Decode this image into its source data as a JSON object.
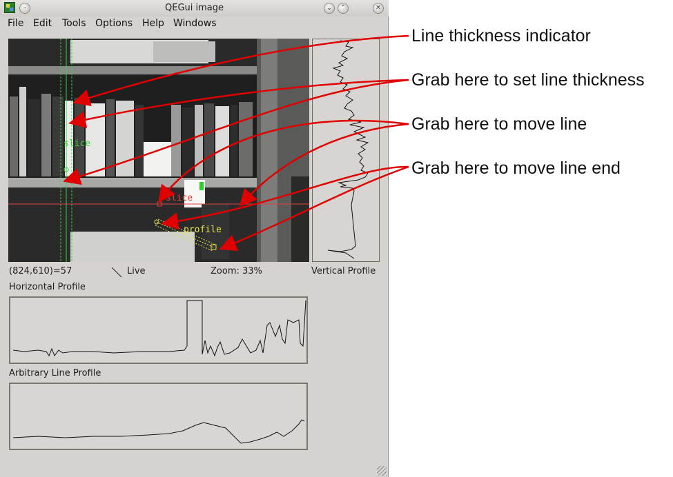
{
  "window": {
    "title": "QEGui image",
    "menu": [
      "File",
      "Edit",
      "Tools",
      "Options",
      "Help",
      "Windows"
    ]
  },
  "titlebar_buttons": {
    "menu": "–",
    "minimize": "⌄",
    "maximize": "⌃",
    "close": "✕"
  },
  "image": {
    "labels": {
      "vertical_slice": "slice",
      "horizontal_slice": "slice",
      "profile": "profile"
    }
  },
  "status": {
    "coords": "(824,610)=57",
    "mode": "Live",
    "zoom": "Zoom: 33%",
    "vertical_profile": "Vertical Profile"
  },
  "sections": {
    "horizontal": "Horizontal Profile",
    "arbitrary": "Arbitrary Line Profile"
  },
  "annotations": [
    "Line thickness indicator",
    "Grab here to set line thickness",
    "Grab here to move line",
    "Grab here to move line end"
  ],
  "colors": {
    "annotation_arrow": "#e00000",
    "slice_line_vertical": "#3fd23f",
    "slice_line_horizontal": "#e04040",
    "profile_line": "#e8e84a",
    "image_bg": "#4a4a48",
    "window_bg": "#d6d2d0"
  }
}
